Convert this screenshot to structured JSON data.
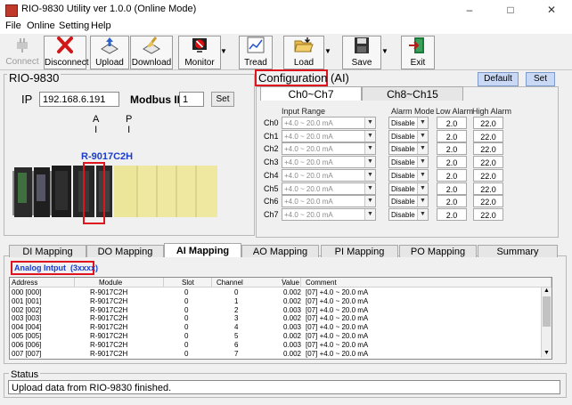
{
  "window": {
    "title": "RIO-9830 Utility  ver 1.0.0 (Online Mode)"
  },
  "menu": [
    "File",
    "Online",
    "Setting",
    "Help"
  ],
  "toolbar": {
    "connect": "Connect",
    "disconnect": "Disconnect",
    "upload": "Upload",
    "download": "Download",
    "monitor": "Monitor",
    "tread": "Tread",
    "load": "Load",
    "save": "Save",
    "exit": "Exit"
  },
  "rio": {
    "title": "RIO-9830",
    "ip_label": "IP",
    "ip_value": "192.168.6.191",
    "modbus_label": "Modbus ID",
    "modbus_value": "1",
    "set_label": "Set",
    "col_a": "A\nI",
    "col_p": "P\nI",
    "module_label": "R-9017C2H"
  },
  "config": {
    "title": "Configuration",
    "title_suffix": " (AI)",
    "default_label": "Default",
    "set_label": "Set",
    "tabs": [
      "Ch0~Ch7",
      "Ch8~Ch15"
    ],
    "headers": {
      "input_range": "Input Range",
      "alarm_mode": "Alarm Mode",
      "low_alarm": "Low Alarm",
      "high_alarm": "High Alarm"
    },
    "rows": [
      {
        "ch": "Ch0",
        "range": "+4.0 ~ 20.0 mA",
        "mode": "Disable",
        "low": "2.0",
        "high": "22.0"
      },
      {
        "ch": "Ch1",
        "range": "+4.0 ~ 20.0 mA",
        "mode": "Disable",
        "low": "2.0",
        "high": "22.0"
      },
      {
        "ch": "Ch2",
        "range": "+4.0 ~ 20.0 mA",
        "mode": "Disable",
        "low": "2.0",
        "high": "22.0"
      },
      {
        "ch": "Ch3",
        "range": "+4.0 ~ 20.0 mA",
        "mode": "Disable",
        "low": "2.0",
        "high": "22.0"
      },
      {
        "ch": "Ch4",
        "range": "+4.0 ~ 20.0 mA",
        "mode": "Disable",
        "low": "2.0",
        "high": "22.0"
      },
      {
        "ch": "Ch5",
        "range": "+4.0 ~ 20.0 mA",
        "mode": "Disable",
        "low": "2.0",
        "high": "22.0"
      },
      {
        "ch": "Ch6",
        "range": "+4.0 ~ 20.0 mA",
        "mode": "Disable",
        "low": "2.0",
        "high": "22.0"
      },
      {
        "ch": "Ch7",
        "range": "+4.0 ~ 20.0 mA",
        "mode": "Disable",
        "low": "2.0",
        "high": "22.0"
      }
    ]
  },
  "mapping": {
    "tabs": [
      "DI Mapping",
      "DO Mapping",
      "AI Mapping",
      "AO Mapping",
      "PI Mapping",
      "PO Mapping",
      "Summary"
    ],
    "active_tab": "AI Mapping",
    "section_label": "Analog Intput  (3xxxx)",
    "columns": [
      "Address",
      "Module",
      "Slot",
      "Channel",
      "Value",
      "Comment"
    ],
    "rows": [
      [
        "000 [000]",
        "R-9017C2H",
        "0",
        "0",
        "0.002",
        "[07] +4.0 ~ 20.0 mA"
      ],
      [
        "001 [001]",
        "R-9017C2H",
        "0",
        "1",
        "0.002",
        "[07] +4.0 ~ 20.0 mA"
      ],
      [
        "002 [002]",
        "R-9017C2H",
        "0",
        "2",
        "0.003",
        "[07] +4.0 ~ 20.0 mA"
      ],
      [
        "003 [003]",
        "R-9017C2H",
        "0",
        "3",
        "0.002",
        "[07] +4.0 ~ 20.0 mA"
      ],
      [
        "004 [004]",
        "R-9017C2H",
        "0",
        "4",
        "0.003",
        "[07] +4.0 ~ 20.0 mA"
      ],
      [
        "005 [005]",
        "R-9017C2H",
        "0",
        "5",
        "0.002",
        "[07] +4.0 ~ 20.0 mA"
      ],
      [
        "006 [006]",
        "R-9017C2H",
        "0",
        "6",
        "0.003",
        "[07] +4.0 ~ 20.0 mA"
      ],
      [
        "007 [007]",
        "R-9017C2H",
        "0",
        "7",
        "0.002",
        "[07] +4.0 ~ 20.0 mA"
      ]
    ]
  },
  "status": {
    "label": "Status",
    "message": "Upload data from RIO-9830 finished."
  },
  "colors": {
    "highlight": "#e0141e",
    "accent_blue": "#1a3ccc"
  }
}
